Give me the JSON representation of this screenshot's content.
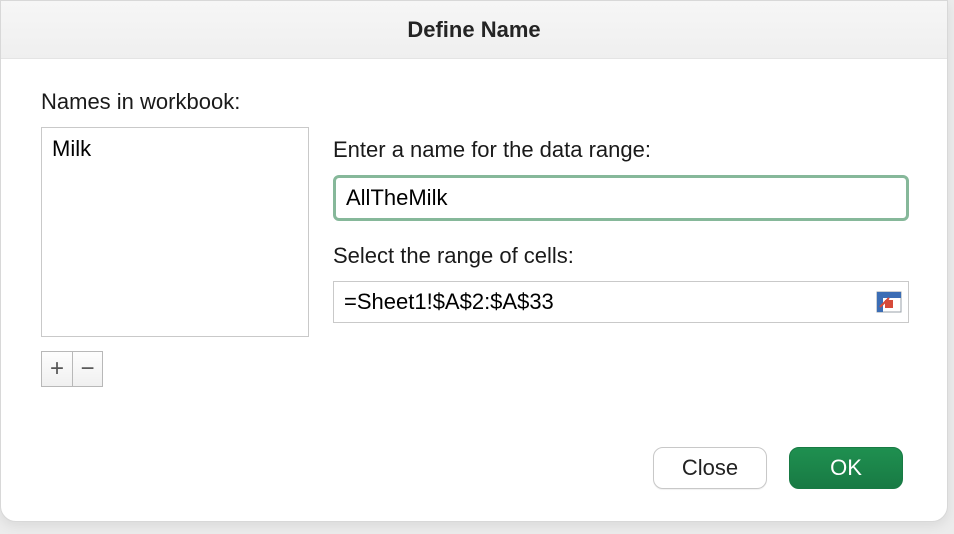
{
  "dialog": {
    "title": "Define Name"
  },
  "left": {
    "label": "Names in workbook:",
    "names": [
      "Milk"
    ],
    "add_glyph": "+",
    "remove_glyph": "−"
  },
  "right": {
    "name_label": "Enter a name for the data range:",
    "name_value": "AllTheMilk",
    "range_label": "Select the range of cells:",
    "range_value": "=Sheet1!$A$2:$A$33"
  },
  "footer": {
    "close_label": "Close",
    "ok_label": "OK"
  }
}
